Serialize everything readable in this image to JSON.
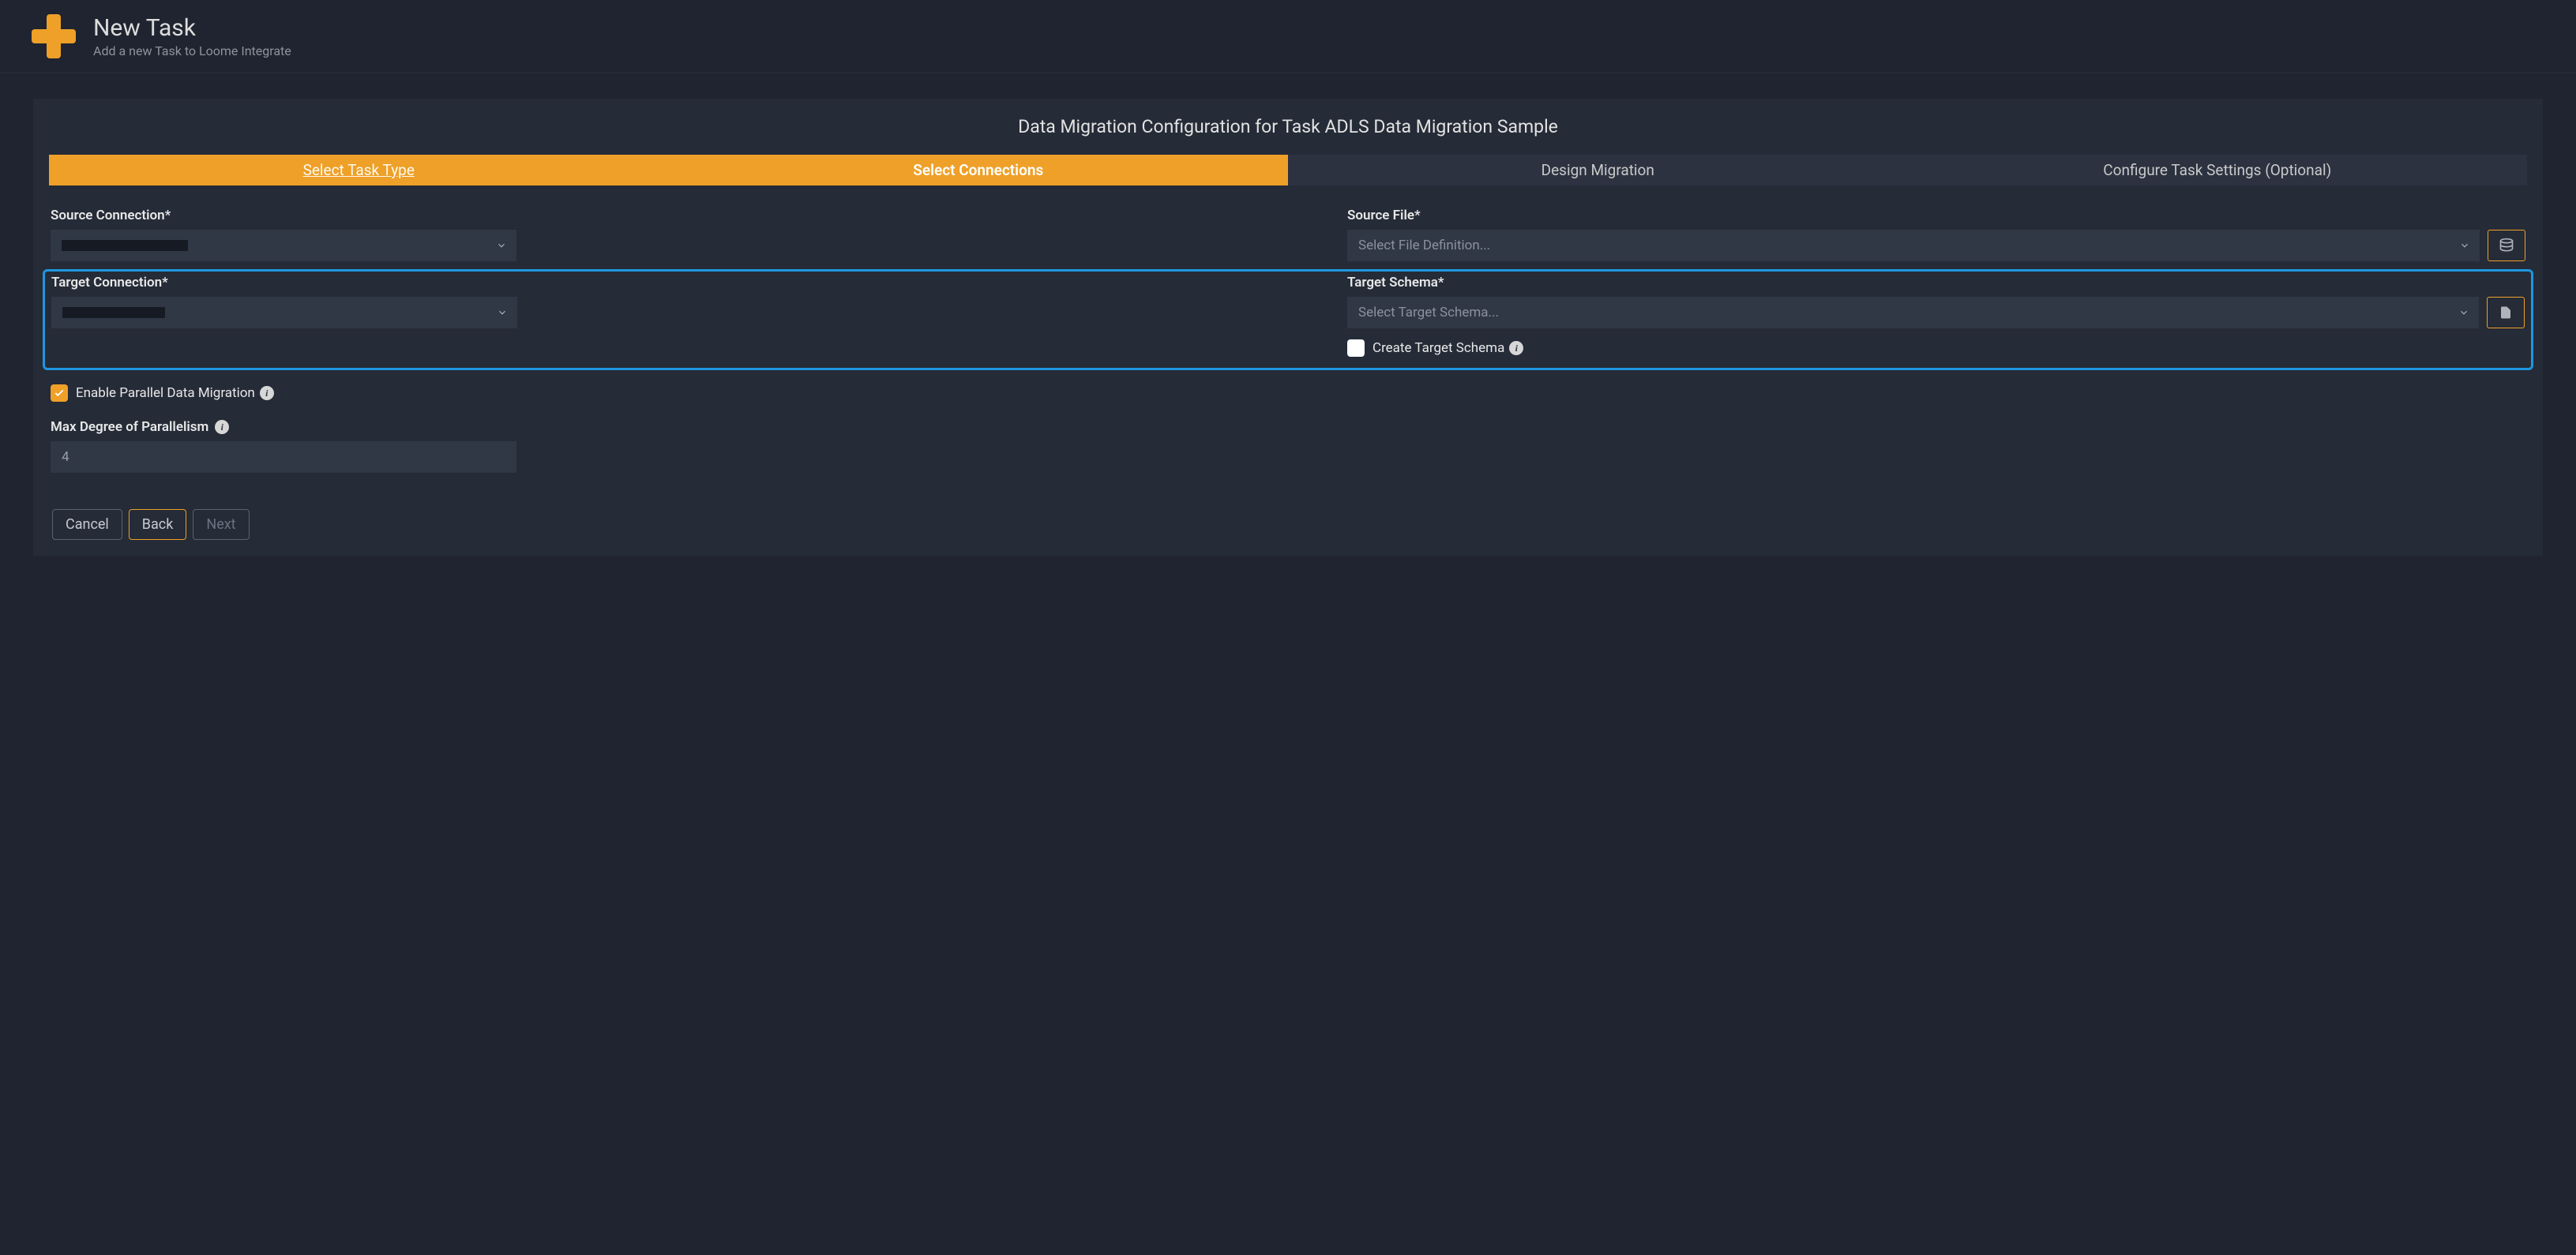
{
  "header": {
    "title": "New Task",
    "subtitle": "Add a new Task to Loome Integrate"
  },
  "panel": {
    "title": "Data Migration Configuration for Task ADLS Data Migration Sample"
  },
  "tabs": [
    {
      "label": "Select Task Type",
      "state": "completed"
    },
    {
      "label": "Select Connections",
      "state": "active"
    },
    {
      "label": "Design Migration",
      "state": "upcoming"
    },
    {
      "label": "Configure Task Settings (Optional)",
      "state": "upcoming"
    }
  ],
  "form": {
    "sourceConnection": {
      "label": "Source Connection*",
      "value": ""
    },
    "sourceFile": {
      "label": "Source File*",
      "placeholder": "Select File Definition..."
    },
    "targetConnection": {
      "label": "Target Connection*",
      "value": ""
    },
    "targetSchema": {
      "label": "Target Schema*",
      "placeholder": "Select Target Schema..."
    },
    "createTargetSchema": {
      "label": "Create Target Schema",
      "checked": false
    },
    "enableParallel": {
      "label": "Enable Parallel Data Migration",
      "checked": true
    },
    "maxParallel": {
      "label": "Max Degree of Parallelism",
      "value": "4"
    }
  },
  "buttons": {
    "cancel": "Cancel",
    "back": "Back",
    "next": "Next"
  }
}
